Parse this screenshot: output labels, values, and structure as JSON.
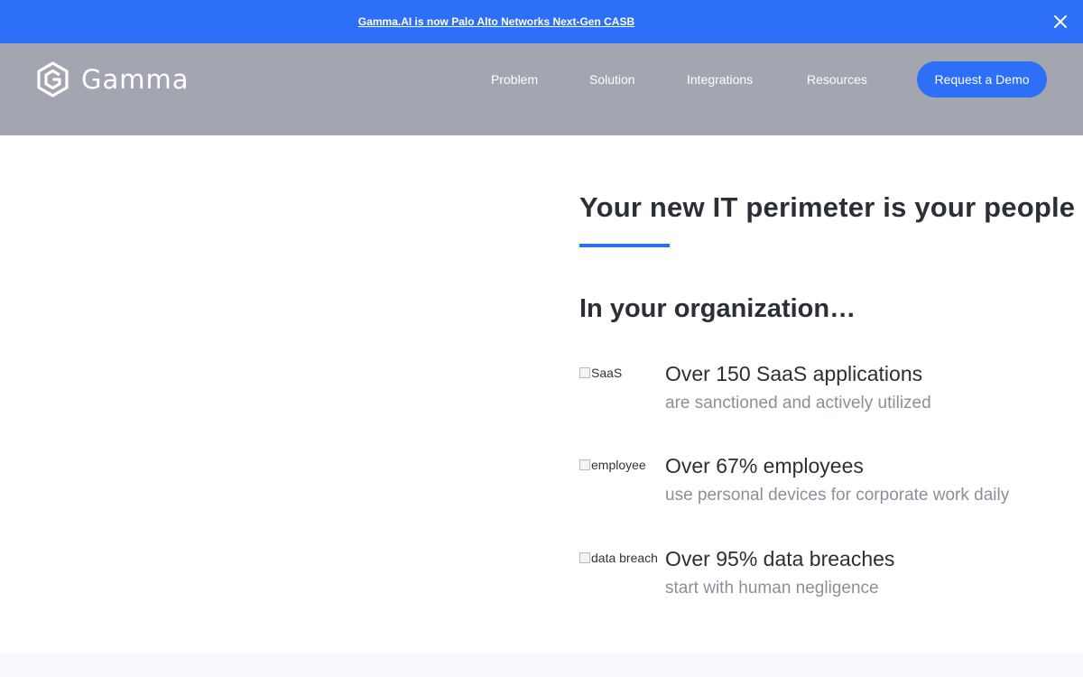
{
  "announcement": {
    "link_text": "Gamma.AI is now Palo Alto Networks Next-Gen CASB",
    "close_icon": "close-icon"
  },
  "navbar": {
    "logo_text": "Gamma",
    "logo_icon": "gamma-logo-icon",
    "links": [
      {
        "label": "Problem"
      },
      {
        "label": "Solution"
      },
      {
        "label": "Integrations"
      },
      {
        "label": "Resources"
      }
    ],
    "cta_label": "Request a Demo"
  },
  "hero": {
    "title": "Your new IT perimeter is your people",
    "subheading": "In your organization…"
  },
  "stats": [
    {
      "img_alt": "SaaS",
      "title": "Over 150 SaaS applications",
      "desc": "are sanctioned and actively utilized"
    },
    {
      "img_alt": "employee",
      "title": "Over 67% employees",
      "desc": "use personal devices for corporate work daily"
    },
    {
      "img_alt": "data breach",
      "title": "Over 95% data breaches",
      "desc": "start with human negligence"
    }
  ],
  "colors": {
    "accent": "#2d6ff7",
    "navbar_bg": "#a3a6b0",
    "text_dark": "#2b2f36",
    "text_muted": "#8a8f99"
  }
}
